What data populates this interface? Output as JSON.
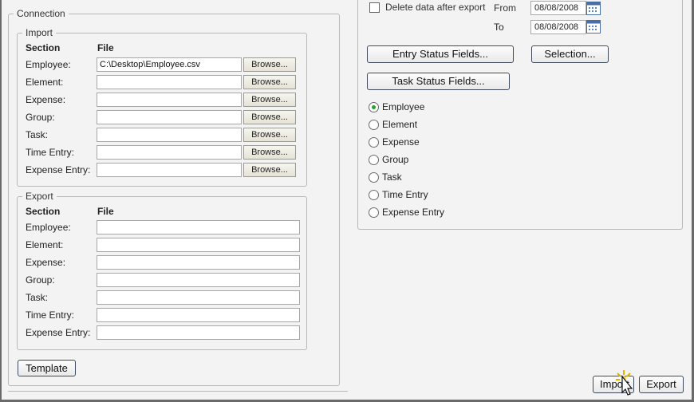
{
  "connection": {
    "legend": "Connection",
    "import": {
      "legend": "Import",
      "section_header": "Section",
      "file_header": "File",
      "browse_label": "Browse...",
      "rows": [
        {
          "label": "Employee:",
          "value": "C:\\Desktop\\Employee.csv"
        },
        {
          "label": "Element:",
          "value": ""
        },
        {
          "label": "Expense:",
          "value": ""
        },
        {
          "label": "Group:",
          "value": ""
        },
        {
          "label": "Task:",
          "value": ""
        },
        {
          "label": "Time Entry:",
          "value": ""
        },
        {
          "label": "Expense Entry:",
          "value": ""
        }
      ]
    },
    "export": {
      "legend": "Export",
      "section_header": "Section",
      "file_header": "File",
      "rows": [
        {
          "label": "Employee:",
          "value": ""
        },
        {
          "label": "Element:",
          "value": ""
        },
        {
          "label": "Expense:",
          "value": ""
        },
        {
          "label": "Group:",
          "value": ""
        },
        {
          "label": "Task:",
          "value": ""
        },
        {
          "label": "Time Entry:",
          "value": ""
        },
        {
          "label": "Expense Entry:",
          "value": ""
        }
      ]
    },
    "template_button": "Template"
  },
  "right_panel": {
    "delete_checkbox_label": "Delete data after export",
    "from_label": "From",
    "from_date": "08/08/2008",
    "to_label": "To",
    "to_date": "08/08/2008",
    "entry_status_button": "Entry Status Fields...",
    "selection_button": "Selection...",
    "task_status_button": "Task Status Fields...",
    "radios": [
      {
        "label": "Employee",
        "checked": true
      },
      {
        "label": "Element",
        "checked": false
      },
      {
        "label": "Expense",
        "checked": false
      },
      {
        "label": "Group",
        "checked": false
      },
      {
        "label": "Task",
        "checked": false
      },
      {
        "label": "Time Entry",
        "checked": false
      },
      {
        "label": "Expense Entry",
        "checked": false
      }
    ]
  },
  "footer": {
    "import_button": "Import",
    "export_button": "Export"
  },
  "colors": {
    "radio_selected": "#2aa02a",
    "button_border": "#3e4a5a"
  }
}
